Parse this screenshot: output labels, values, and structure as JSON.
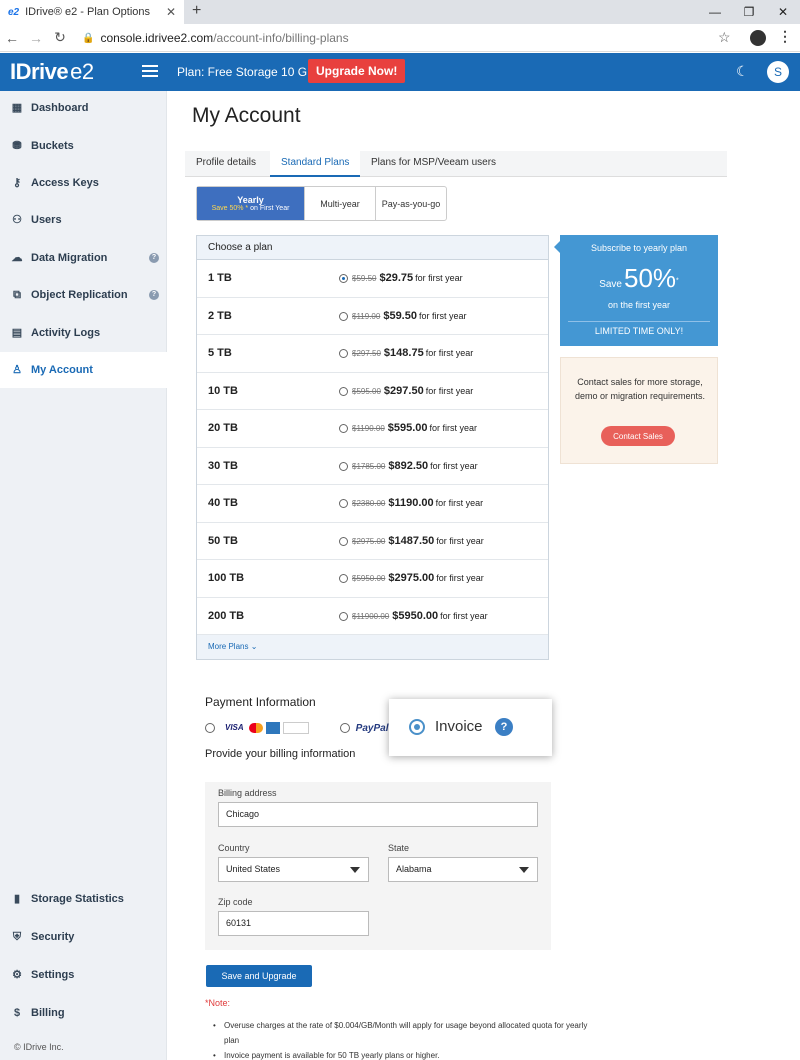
{
  "browser": {
    "tab_title": "IDrive® e2 - Plan Options",
    "tab_favicon": "e2",
    "url_host": "console.idrivee2.com",
    "url_path": "/account-info/billing-plans"
  },
  "header": {
    "logo_text": "IDrive",
    "logo_suffix": "e2",
    "plan_label": "Plan: Free Storage 10 GB",
    "upgrade_label": "Upgrade Now!",
    "avatar_initial": "S",
    "brand_color": "#1a6ab5"
  },
  "sidebar": {
    "items": [
      {
        "label": "Dashboard",
        "icon": "dashboard-icon"
      },
      {
        "label": "Buckets",
        "icon": "bucket-icon"
      },
      {
        "label": "Access Keys",
        "icon": "key-icon"
      },
      {
        "label": "Users",
        "icon": "users-icon"
      },
      {
        "label": "Data Migration",
        "icon": "cloud-migration-icon"
      },
      {
        "label": "Object Replication",
        "icon": "replication-icon"
      },
      {
        "label": "Activity Logs",
        "icon": "logs-icon"
      },
      {
        "label": "My Account",
        "icon": "user-icon"
      }
    ],
    "bottom_items": [
      {
        "label": "Storage Statistics",
        "icon": "stats-icon"
      },
      {
        "label": "Security",
        "icon": "shield-icon"
      },
      {
        "label": "Settings",
        "icon": "gear-icon"
      },
      {
        "label": "Billing",
        "icon": "dollar-icon"
      }
    ],
    "copyright": "© IDrive Inc."
  },
  "main": {
    "title": "My Account",
    "tabs": [
      "Profile details",
      "Standard Plans",
      "Plans for MSP/Veeam users"
    ],
    "billing_options": {
      "yearly": "Yearly",
      "yearly_sub_highlight": "Save 50% *",
      "yearly_sub_rest": " on First Year",
      "multiyear": "Multi-year",
      "payg": "Pay-as-you-go"
    },
    "plans_header": "Choose a plan",
    "plans": [
      {
        "name": "1 TB",
        "old": "$59.50",
        "new": "$29.75",
        "suffix": "for first year",
        "selected": true
      },
      {
        "name": "2 TB",
        "old": "$119.00",
        "new": "$59.50",
        "suffix": "for first year",
        "selected": false
      },
      {
        "name": "5 TB",
        "old": "$297.50",
        "new": "$148.75",
        "suffix": "for first year",
        "selected": false
      },
      {
        "name": "10 TB",
        "old": "$595.00",
        "new": "$297.50",
        "suffix": "for first year",
        "selected": false
      },
      {
        "name": "20 TB",
        "old": "$1190.00",
        "new": "$595.00",
        "suffix": "for first year",
        "selected": false
      },
      {
        "name": "30 TB",
        "old": "$1785.00",
        "new": "$892.50",
        "suffix": "for first year",
        "selected": false
      },
      {
        "name": "40 TB",
        "old": "$2380.00",
        "new": "$1190.00",
        "suffix": "for first year",
        "selected": false
      },
      {
        "name": "50 TB",
        "old": "$2975.00",
        "new": "$1487.50",
        "suffix": "for first year",
        "selected": false
      },
      {
        "name": "100 TB",
        "old": "$5950.00",
        "new": "$2975.00",
        "suffix": "for first year",
        "selected": false
      },
      {
        "name": "200 TB",
        "old": "$11900.00",
        "new": "$5950.00",
        "suffix": "for first year",
        "selected": false
      }
    ],
    "more_plans": "More Plans",
    "promo": {
      "line1": "Subscribe to yearly plan",
      "save_word": "Save",
      "save_pct": "50%",
      "asterisk": "*",
      "line3": "on the first year",
      "line4": "LIMITED TIME ONLY!"
    },
    "contact": {
      "text": "Contact sales for more storage, demo or migration requirements.",
      "button": "Contact Sales"
    },
    "payment": {
      "heading": "Payment Information",
      "card_brands": [
        "VISA",
        "MC",
        "AMEX",
        "DISCOVER"
      ],
      "paypal": "PayPal",
      "invoice": "Invoice"
    },
    "billing": {
      "heading": "Provide your billing information",
      "address_label": "Billing address",
      "address_value": "Chicago",
      "country_label": "Country",
      "country_value": "United States",
      "state_label": "State",
      "state_value": "Alabama",
      "zip_label": "Zip code",
      "zip_value": "60131"
    },
    "save_button": "Save and Upgrade",
    "note_label": "*Note:",
    "notes": [
      "Overuse charges at the rate of $0.004/GB/Month will apply for usage beyond allocated quota for yearly plan",
      "Invoice payment is available for 50 TB yearly plans or higher."
    ]
  }
}
